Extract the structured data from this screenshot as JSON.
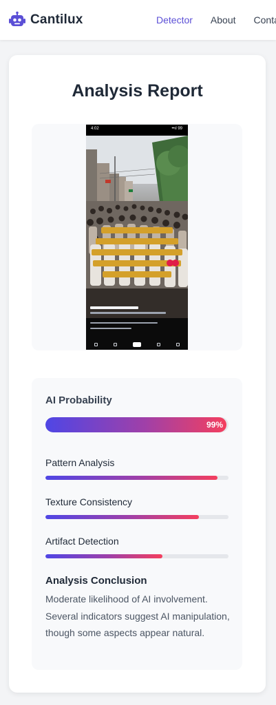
{
  "brand": {
    "name": "Cantilux",
    "icon": "robot-icon",
    "accent": "#5b4fd6"
  },
  "nav": {
    "links": [
      {
        "label": "Detector",
        "active": true
      },
      {
        "label": "About",
        "active": false
      },
      {
        "label": "Conta",
        "active": false
      }
    ]
  },
  "report": {
    "title": "Analysis Report"
  },
  "phone": {
    "time": "4:02",
    "status_right": "••ıl 99"
  },
  "stats": {
    "ai_probability": {
      "label": "AI Probability",
      "value": 99,
      "value_text": "99%"
    },
    "metrics": [
      {
        "label": "Pattern Analysis",
        "value": 94
      },
      {
        "label": "Texture Consistency",
        "value": 84
      },
      {
        "label": "Artifact Detection",
        "value": 64
      }
    ],
    "conclusion": {
      "title": "Analysis Conclusion",
      "text": "Moderate likelihood of AI involvement. Several indicators suggest AI manipulation, though some aspects appear natural."
    }
  },
  "colors": {
    "gradient_start": "#4f46e5",
    "gradient_end": "#f43f5e",
    "track": "#e5e7eb"
  }
}
